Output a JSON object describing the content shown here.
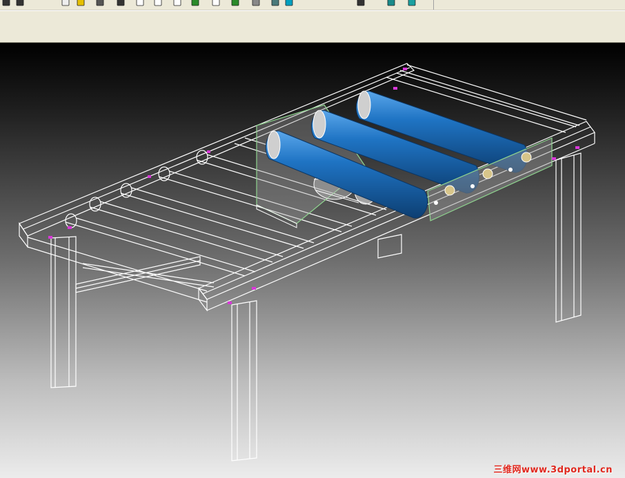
{
  "toolbar": {
    "buttons": [
      {
        "name": "grid-icon"
      },
      {
        "name": "pipe-icon"
      },
      {
        "name": "page-icon"
      },
      {
        "name": "folder-icon"
      },
      {
        "name": "gear-icon"
      },
      {
        "name": "table-icon"
      },
      {
        "name": "doc-icon"
      },
      {
        "name": "doc2-icon"
      },
      {
        "name": "doc3-icon"
      },
      {
        "name": "green-arrow-icon"
      },
      {
        "name": "chart-icon"
      },
      {
        "name": "green-tool-icon"
      },
      {
        "name": "arrow-icon"
      },
      {
        "name": "screen-icon"
      },
      {
        "name": "pin-icon"
      },
      {
        "name": "rotate-icon"
      },
      {
        "name": "cube-icon"
      },
      {
        "name": "tool-icon"
      }
    ]
  },
  "viewport": {
    "background": "#000000",
    "wire_color": "#ffffff",
    "roller_color": "#1f74c4",
    "guard_color": "#8fd48f",
    "marker_color": "#d838d8"
  },
  "watermark": {
    "text": "三维网www.3dportal.cn",
    "color": "#e0281e"
  }
}
